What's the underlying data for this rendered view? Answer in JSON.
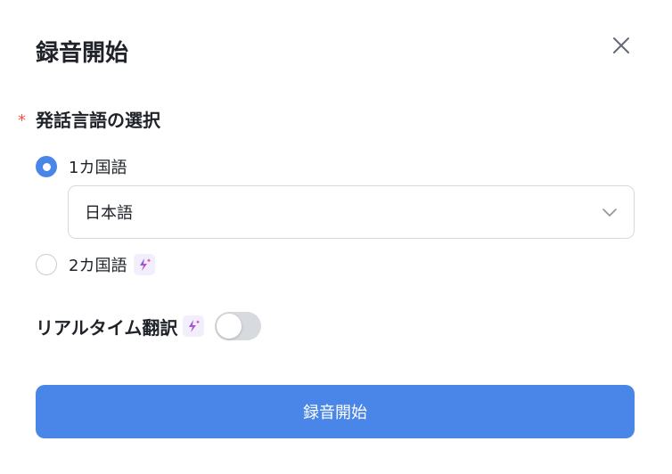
{
  "dialog": {
    "title": "録音開始",
    "close_icon": "close-icon"
  },
  "language_field": {
    "required_mark": "*",
    "label": "発話言語の選択",
    "options": [
      {
        "label": "1カ国語",
        "selected": true
      },
      {
        "label": "2カ国語",
        "selected": false,
        "badge_icon": "ai-sparkle-icon"
      }
    ],
    "select": {
      "value": "日本語",
      "icon": "chevron-down-icon"
    }
  },
  "realtime_translation": {
    "label": "リアルタイム翻訳",
    "badge_icon": "ai-sparkle-icon",
    "enabled": false
  },
  "start_button": {
    "label": "録音開始"
  },
  "colors": {
    "accent": "#4a86e8",
    "required": "#f0544f",
    "ai_badge_bg": "#f3eefc"
  }
}
